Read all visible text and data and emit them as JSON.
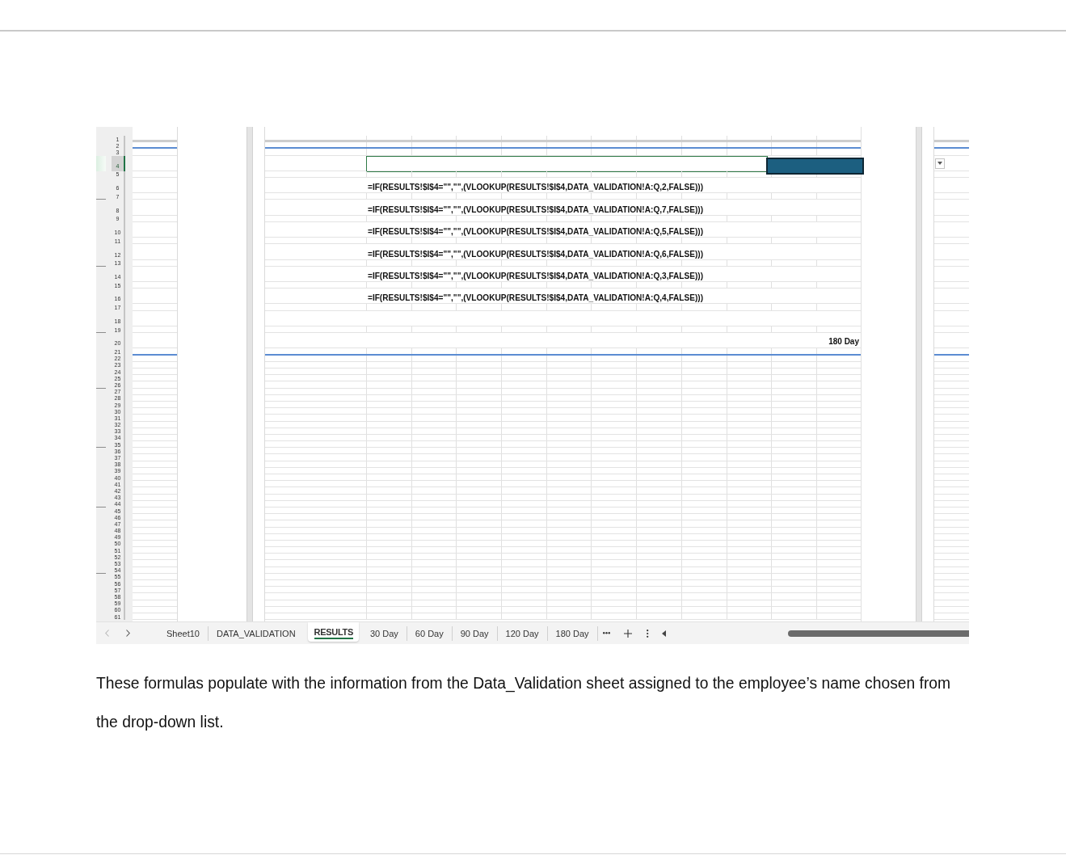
{
  "spreadsheet": {
    "rows": [
      {
        "header": "1",
        "selected": false,
        "kind": "short"
      },
      {
        "header": "2",
        "selected": false,
        "kind": "short"
      },
      {
        "header": "3",
        "selected": false,
        "kind": "short"
      },
      {
        "header": "4",
        "selected": true,
        "kind": "input"
      },
      {
        "header": "5",
        "selected": false,
        "kind": "short"
      },
      {
        "header": "6",
        "selected": false,
        "kind": "formula",
        "text": "=IF(RESULTS!$I$4=\"\",\"\",(VLOOKUP(RESULTS!$I$4,DATA_VALIDATION!A:Q,2,FALSE)))"
      },
      {
        "header": "7",
        "selected": false,
        "kind": "short"
      },
      {
        "header": "8",
        "selected": false,
        "kind": "formula",
        "text": "=IF(RESULTS!$I$4=\"\",\"\",(VLOOKUP(RESULTS!$I$4,DATA_VALIDATION!A:Q,7,FALSE)))"
      },
      {
        "header": "9",
        "selected": false,
        "kind": "short"
      },
      {
        "header": "10",
        "selected": false,
        "kind": "formula",
        "text": "=IF(RESULTS!$I$4=\"\",\"\",(VLOOKUP(RESULTS!$I$4,DATA_VALIDATION!A:Q,5,FALSE)))"
      },
      {
        "header": "11",
        "selected": false,
        "kind": "short"
      },
      {
        "header": "12",
        "selected": false,
        "kind": "formula",
        "text": "=IF(RESULTS!$I$4=\"\",\"\",(VLOOKUP(RESULTS!$I$4,DATA_VALIDATION!A:Q,6,FALSE)))"
      },
      {
        "header": "13",
        "selected": false,
        "kind": "short"
      },
      {
        "header": "14",
        "selected": false,
        "kind": "formula",
        "text": "=IF(RESULTS!$I$4=\"\",\"\",(VLOOKUP(RESULTS!$I$4,DATA_VALIDATION!A:Q,3,FALSE)))"
      },
      {
        "header": "15",
        "selected": false,
        "kind": "short"
      },
      {
        "header": "16",
        "selected": false,
        "kind": "formula",
        "text": "=IF(RESULTS!$I$4=\"\",\"\",(VLOOKUP(RESULTS!$I$4,DATA_VALIDATION!A:Q,4,FALSE)))"
      },
      {
        "header": "17",
        "selected": false,
        "kind": "short"
      },
      {
        "header": "18",
        "selected": false,
        "kind": "tall"
      },
      {
        "header": "19",
        "selected": false,
        "kind": "short"
      },
      {
        "header": "20",
        "selected": false,
        "kind": "heading",
        "text": "180 Day"
      },
      {
        "header": "21",
        "selected": false,
        "kind": "short"
      },
      {
        "header": "22",
        "selected": false,
        "kind": "short"
      },
      {
        "header": "23",
        "selected": false,
        "kind": "short"
      },
      {
        "header": "24",
        "selected": false,
        "kind": "short"
      },
      {
        "header": "25",
        "selected": false,
        "kind": "short"
      },
      {
        "header": "26",
        "selected": false,
        "kind": "short"
      },
      {
        "header": "27",
        "selected": false,
        "kind": "short"
      },
      {
        "header": "28",
        "selected": false,
        "kind": "short"
      },
      {
        "header": "29",
        "selected": false,
        "kind": "short"
      },
      {
        "header": "30",
        "selected": false,
        "kind": "short"
      },
      {
        "header": "31",
        "selected": false,
        "kind": "short"
      },
      {
        "header": "32",
        "selected": false,
        "kind": "short"
      },
      {
        "header": "33",
        "selected": false,
        "kind": "short"
      },
      {
        "header": "34",
        "selected": false,
        "kind": "short"
      },
      {
        "header": "35",
        "selected": false,
        "kind": "short"
      },
      {
        "header": "36",
        "selected": false,
        "kind": "short"
      },
      {
        "header": "37",
        "selected": false,
        "kind": "short"
      },
      {
        "header": "38",
        "selected": false,
        "kind": "short"
      },
      {
        "header": "39",
        "selected": false,
        "kind": "short"
      },
      {
        "header": "40",
        "selected": false,
        "kind": "short"
      },
      {
        "header": "41",
        "selected": false,
        "kind": "short"
      },
      {
        "header": "42",
        "selected": false,
        "kind": "short"
      },
      {
        "header": "43",
        "selected": false,
        "kind": "short"
      },
      {
        "header": "44",
        "selected": false,
        "kind": "short"
      },
      {
        "header": "45",
        "selected": false,
        "kind": "short"
      },
      {
        "header": "46",
        "selected": false,
        "kind": "short"
      },
      {
        "header": "47",
        "selected": false,
        "kind": "short"
      },
      {
        "header": "48",
        "selected": false,
        "kind": "short"
      },
      {
        "header": "49",
        "selected": false,
        "kind": "short"
      },
      {
        "header": "50",
        "selected": false,
        "kind": "short"
      },
      {
        "header": "51",
        "selected": false,
        "kind": "short"
      },
      {
        "header": "52",
        "selected": false,
        "kind": "short"
      },
      {
        "header": "53",
        "selected": false,
        "kind": "short"
      },
      {
        "header": "54",
        "selected": false,
        "kind": "short"
      },
      {
        "header": "55",
        "selected": false,
        "kind": "short"
      },
      {
        "header": "56",
        "selected": false,
        "kind": "short"
      },
      {
        "header": "57",
        "selected": false,
        "kind": "short"
      },
      {
        "header": "58",
        "selected": false,
        "kind": "short"
      },
      {
        "header": "59",
        "selected": false,
        "kind": "short"
      },
      {
        "header": "60",
        "selected": false,
        "kind": "short"
      },
      {
        "header": "61",
        "selected": false,
        "kind": "short"
      }
    ]
  },
  "sheet_tabs": {
    "previous": {
      "disabled": true
    },
    "next": {
      "disabled": false
    },
    "tabs": [
      {
        "label": "Sheet10",
        "selected": false
      },
      {
        "label": "DATA_VALIDATION",
        "selected": false
      },
      {
        "label": "RESULTS",
        "selected": true
      },
      {
        "label": "30 Day",
        "selected": false
      },
      {
        "label": "60 Day",
        "selected": false
      },
      {
        "label": "90 Day",
        "selected": false
      },
      {
        "label": "120 Day",
        "selected": false
      },
      {
        "label": "180 Day",
        "selected": false
      }
    ]
  },
  "caption": "These formulas populate with the information from the Data_Validation sheet assigned to the employee’s name chosen from the drop-down list."
}
